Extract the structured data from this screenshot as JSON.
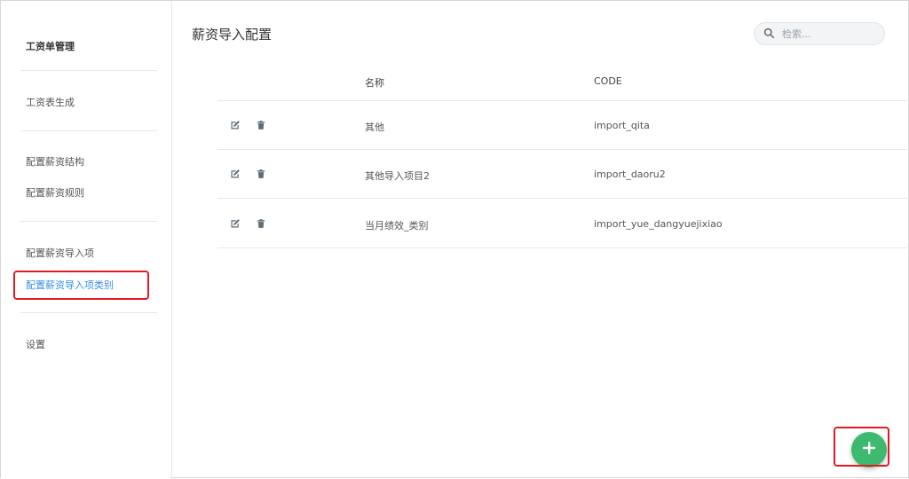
{
  "sidebar": {
    "title": "工资单管理",
    "items": [
      {
        "label": "工资表生成"
      },
      {
        "label": "配置薪资结构"
      },
      {
        "label": "配置薪资规则"
      },
      {
        "label": "配置薪资导入项"
      },
      {
        "label": "配置薪资导入项类别",
        "active": true
      },
      {
        "label": "设置"
      }
    ]
  },
  "header": {
    "title": "薪资导入配置",
    "search_placeholder": "检索..."
  },
  "table": {
    "columns": [
      "名称",
      "CODE"
    ],
    "rows": [
      {
        "name": "其他",
        "code": "import_qita"
      },
      {
        "name": "其他导入项目2",
        "code": "import_daoru2"
      },
      {
        "name": "当月绩效_类别",
        "code": "import_yue_dangyuejixiao"
      }
    ]
  },
  "colors": {
    "accent": "#3a8ee6",
    "fab": "#3dba6f",
    "highlight": "#e01b24"
  },
  "icons": {
    "row_actions": [
      "edit-icon",
      "trash-icon"
    ],
    "search": "search-icon",
    "fab": "plus-icon"
  }
}
